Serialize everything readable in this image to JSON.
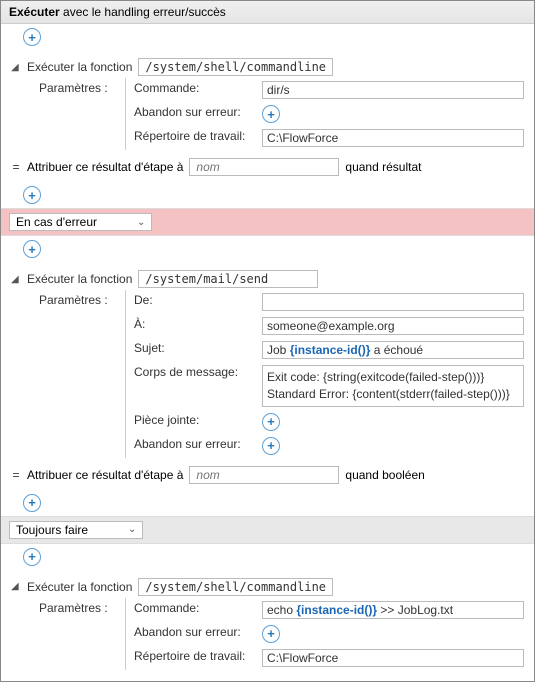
{
  "header": {
    "bold": "Exécuter",
    "rest": " avec le handling erreur/succès"
  },
  "step1": {
    "funcLabel": "Exécuter la fonction",
    "funcPath": "/system/shell/commandline",
    "paramsLabel": "Paramètres :",
    "params": {
      "command": {
        "label": "Commande:",
        "value": "dir/s"
      },
      "abort": {
        "label": "Abandon sur erreur:"
      },
      "wd": {
        "label": "Répertoire de travail:",
        "value": "C:\\FlowForce"
      }
    },
    "assign": {
      "label": "Attribuer ce résultat d'étape à",
      "placeholder": "nom",
      "suffix": "quand résultat"
    }
  },
  "errorSection": {
    "title": "En cas d'erreur"
  },
  "step2": {
    "funcLabel": "Exécuter la fonction",
    "funcPath": "/system/mail/send",
    "paramsLabel": "Paramètres :",
    "params": {
      "from": {
        "label": "De:",
        "value": ""
      },
      "to": {
        "label": "À:",
        "value": "someone@example.org"
      },
      "subject": {
        "label": "Sujet:",
        "prefix": "Job ",
        "expr": "{instance-id()}",
        "suffix": " a échoué"
      },
      "body": {
        "label": "Corps de message:",
        "line1": "Exit code: {string(exitcode(failed-step()))}",
        "line2": "Standard Error: {content(stderr(failed-step()))}"
      },
      "attach": {
        "label": "Pièce jointe:"
      },
      "abort": {
        "label": "Abandon sur erreur:"
      }
    },
    "assign": {
      "label": "Attribuer ce résultat d'étape à",
      "placeholder": "nom",
      "suffix": "quand booléen"
    }
  },
  "alwaysSection": {
    "title": "Toujours faire"
  },
  "step3": {
    "funcLabel": "Exécuter la fonction",
    "funcPath": "/system/shell/commandline",
    "paramsLabel": "Paramètres :",
    "params": {
      "command": {
        "label": "Commande:",
        "prefix": "echo ",
        "expr": "{instance-id()}",
        "suffix": " >> JobLog.txt"
      },
      "abort": {
        "label": "Abandon sur erreur:"
      },
      "wd": {
        "label": "Répertoire de travail:",
        "value": "C:\\FlowForce"
      }
    }
  }
}
